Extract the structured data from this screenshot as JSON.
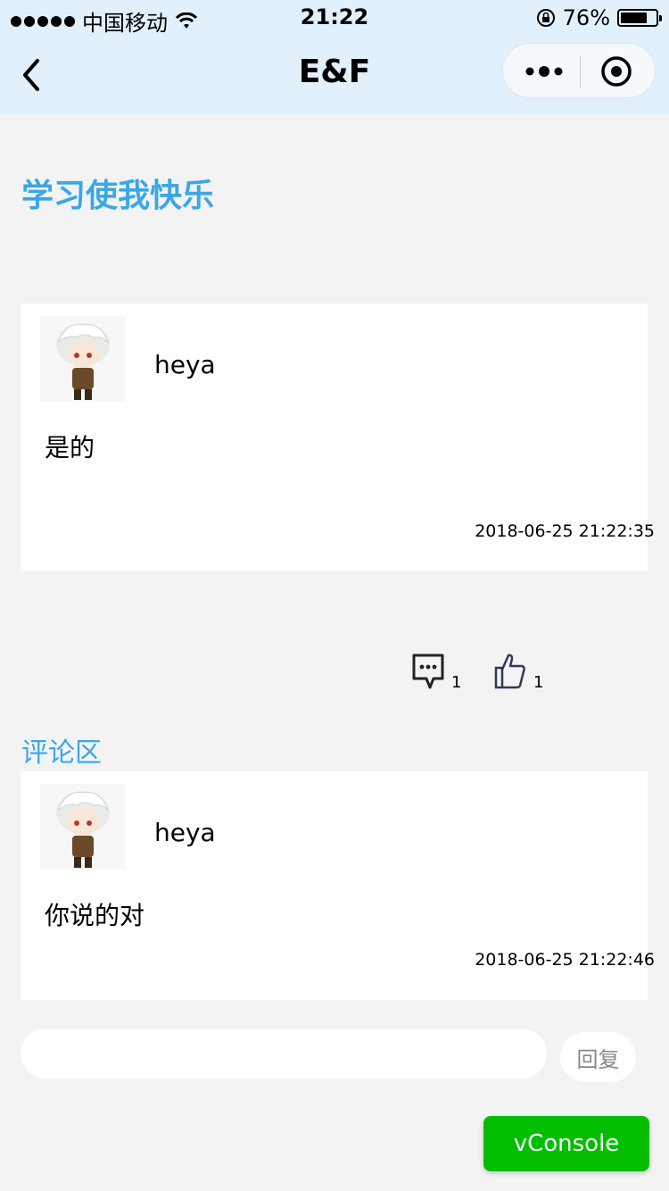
{
  "status_bar": {
    "carrier": "中国移动",
    "time": "21:22",
    "battery_percent_text": "76%",
    "battery_level": 0.76,
    "icons": [
      "signal-dots-icon",
      "wifi-icon",
      "orientation-lock-icon",
      "battery-icon"
    ]
  },
  "nav": {
    "title": "E&F",
    "back_icon": "chevron-left-icon",
    "more_icon": "more-dots-icon",
    "close_icon": "target-close-icon"
  },
  "post": {
    "title": "学习使我快乐",
    "author": "heya",
    "content": "是的",
    "timestamp": "2018-06-25 21:22:35",
    "comment_count": "1",
    "like_count": "1"
  },
  "comments": {
    "header": "评论区",
    "items": [
      {
        "author": "heya",
        "content": "你说的对",
        "timestamp": "2018-06-25 21:22:46"
      }
    ]
  },
  "reply": {
    "placeholder": "",
    "button_label": "回复"
  },
  "vconsole": {
    "label": "vConsole"
  },
  "colors": {
    "accent": "#3aa7e6",
    "navbar_bg": "#e1f0fb",
    "page_bg": "#f3f3f3",
    "vconsole_bg": "#04be02"
  }
}
